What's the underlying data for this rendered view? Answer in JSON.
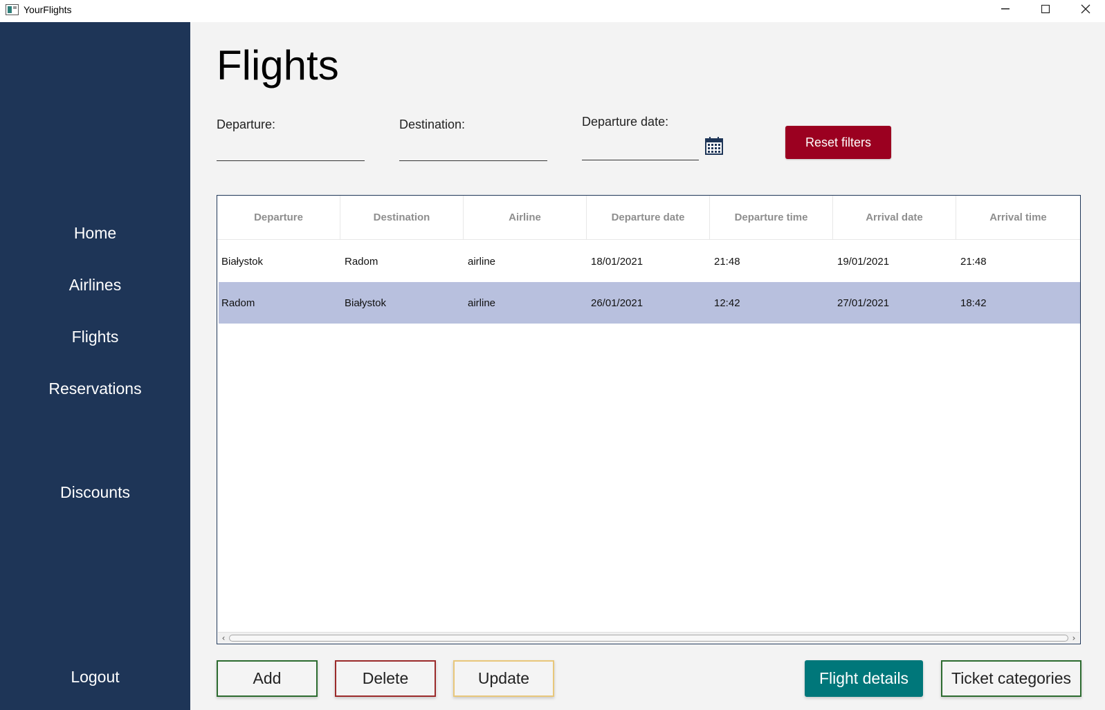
{
  "window": {
    "title": "YourFlights"
  },
  "sidebar": {
    "items": [
      {
        "label": "Home"
      },
      {
        "label": "Airlines"
      },
      {
        "label": "Flights"
      },
      {
        "label": "Reservations"
      },
      {
        "label": "Discounts"
      },
      {
        "label": "Logout"
      }
    ]
  },
  "page": {
    "title": "Flights"
  },
  "filters": {
    "departure_label": "Departure:",
    "departure_value": "",
    "destination_label": "Destination:",
    "destination_value": "",
    "date_label": "Departure date:",
    "date_value": "",
    "reset_label": "Reset filters"
  },
  "table": {
    "columns": [
      "Departure",
      "Destination",
      "Airline",
      "Departure date",
      "Departure time",
      "Arrival date",
      "Arrival time"
    ],
    "rows": [
      [
        "Białystok",
        "Radom",
        "airline",
        "18/01/2021",
        "21:48",
        "19/01/2021",
        "21:48"
      ],
      [
        "Radom",
        "Białystok",
        "airline",
        "26/01/2021",
        "12:42",
        "27/01/2021",
        "18:42"
      ]
    ],
    "selected_row": 1
  },
  "actions": {
    "add": "Add",
    "delete": "Delete",
    "update": "Update",
    "flight_details": "Flight details",
    "ticket_categories": "Ticket categories"
  },
  "colors": {
    "sidebar": "#1e3557",
    "reset": "#9b0020",
    "details": "#00777a",
    "selected_row": "#b8c0de"
  }
}
